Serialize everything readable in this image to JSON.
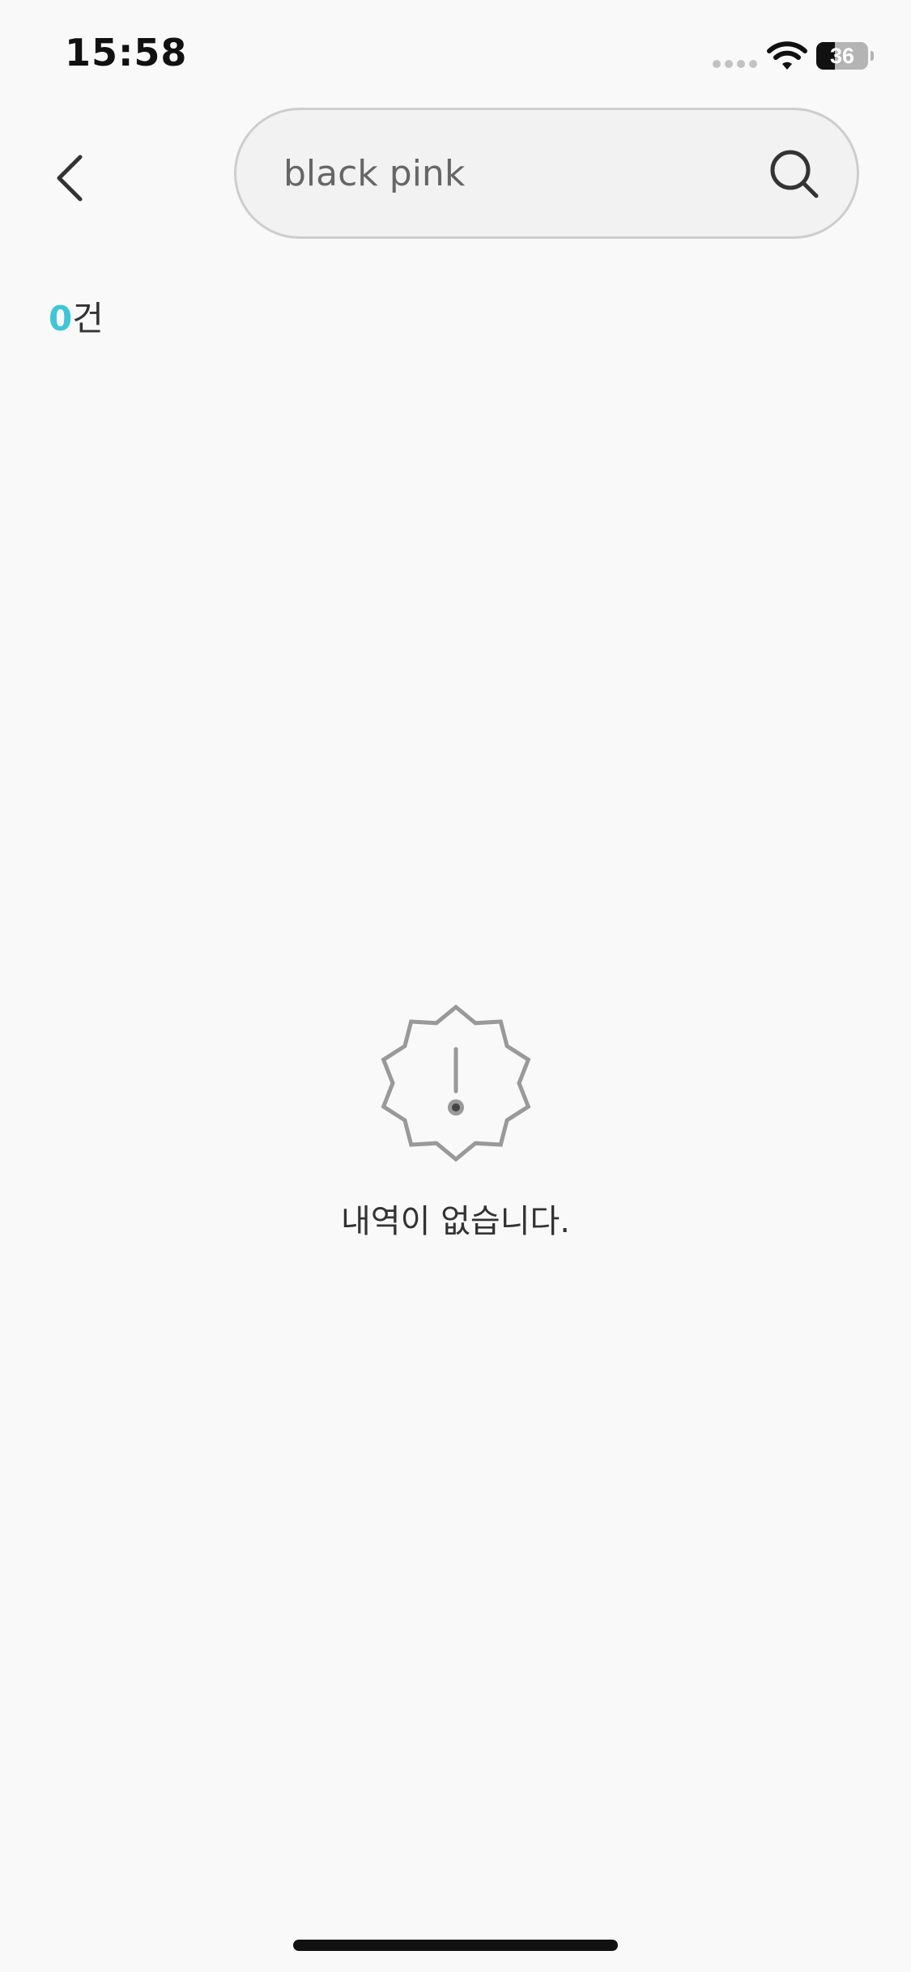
{
  "status_bar": {
    "time": "15:58",
    "battery_level": 36,
    "battery_text": "36",
    "icons": [
      "cellular-signal-icon",
      "wifi-icon",
      "battery-icon"
    ]
  },
  "header": {
    "back_icon": "chevron-left-icon",
    "search": {
      "value": "black pink",
      "placeholder": "",
      "icon": "search-icon"
    }
  },
  "results": {
    "count": "0",
    "count_suffix": "건"
  },
  "empty_state": {
    "icon": "alert-badge-icon",
    "message": "내역이 없습니다."
  },
  "colors": {
    "accent": "#3ec6d6",
    "background": "#f9f9f9",
    "search_field": "#f2f2f2",
    "text": "#333333",
    "icon_gray": "#999999"
  }
}
